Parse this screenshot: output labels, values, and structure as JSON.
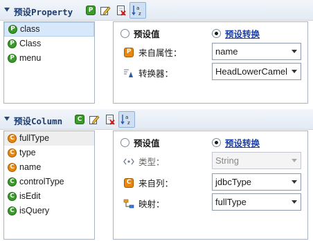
{
  "property": {
    "title": "预设Property",
    "toolbar": {
      "add_label": "P",
      "edit": "edit-icon",
      "delete": "delete-icon",
      "sort": "sort-az-icon"
    },
    "list": {
      "items": [
        {
          "label": "class",
          "icon": "P",
          "selected": true
        },
        {
          "label": "Class",
          "icon": "P"
        },
        {
          "label": "menu",
          "icon": "P"
        }
      ]
    },
    "mode": {
      "preset_value": "预设值",
      "preset_convert": "预设转换",
      "selected": "preset_convert"
    },
    "fields": {
      "source_label": "来自属性：",
      "source_icon": "P",
      "source_value": "name",
      "converter_label": "转换器：",
      "converter_value": "HeadLowerCamel"
    }
  },
  "column": {
    "title": "预设Column",
    "toolbar": {
      "add_label": "C",
      "edit": "edit-icon",
      "delete": "delete-icon",
      "sort": "sort-az-icon"
    },
    "list": {
      "items": [
        {
          "label": "fullType",
          "icon": "C",
          "color": "orange",
          "hover": true
        },
        {
          "label": "type",
          "icon": "C",
          "color": "orange"
        },
        {
          "label": "name",
          "icon": "C",
          "color": "orange"
        },
        {
          "label": "controlType",
          "icon": "C",
          "color": "green"
        },
        {
          "label": "isEdit",
          "icon": "C",
          "color": "green"
        },
        {
          "label": "isQuery",
          "icon": "C",
          "color": "green"
        }
      ]
    },
    "mode": {
      "preset_value": "预设值",
      "preset_convert": "预设转换",
      "selected": "preset_convert"
    },
    "fields": {
      "type_label": "类型：",
      "type_value": "String",
      "source_label": "来自列：",
      "source_icon": "C",
      "source_value": "jdbcType",
      "mapping_label": "映射：",
      "mapping_value": "fullType"
    }
  },
  "colors": {
    "green": "#3a9a2a",
    "orange": "#e8870f",
    "link": "#1a3fa8",
    "selection": "#d8e8fb"
  }
}
